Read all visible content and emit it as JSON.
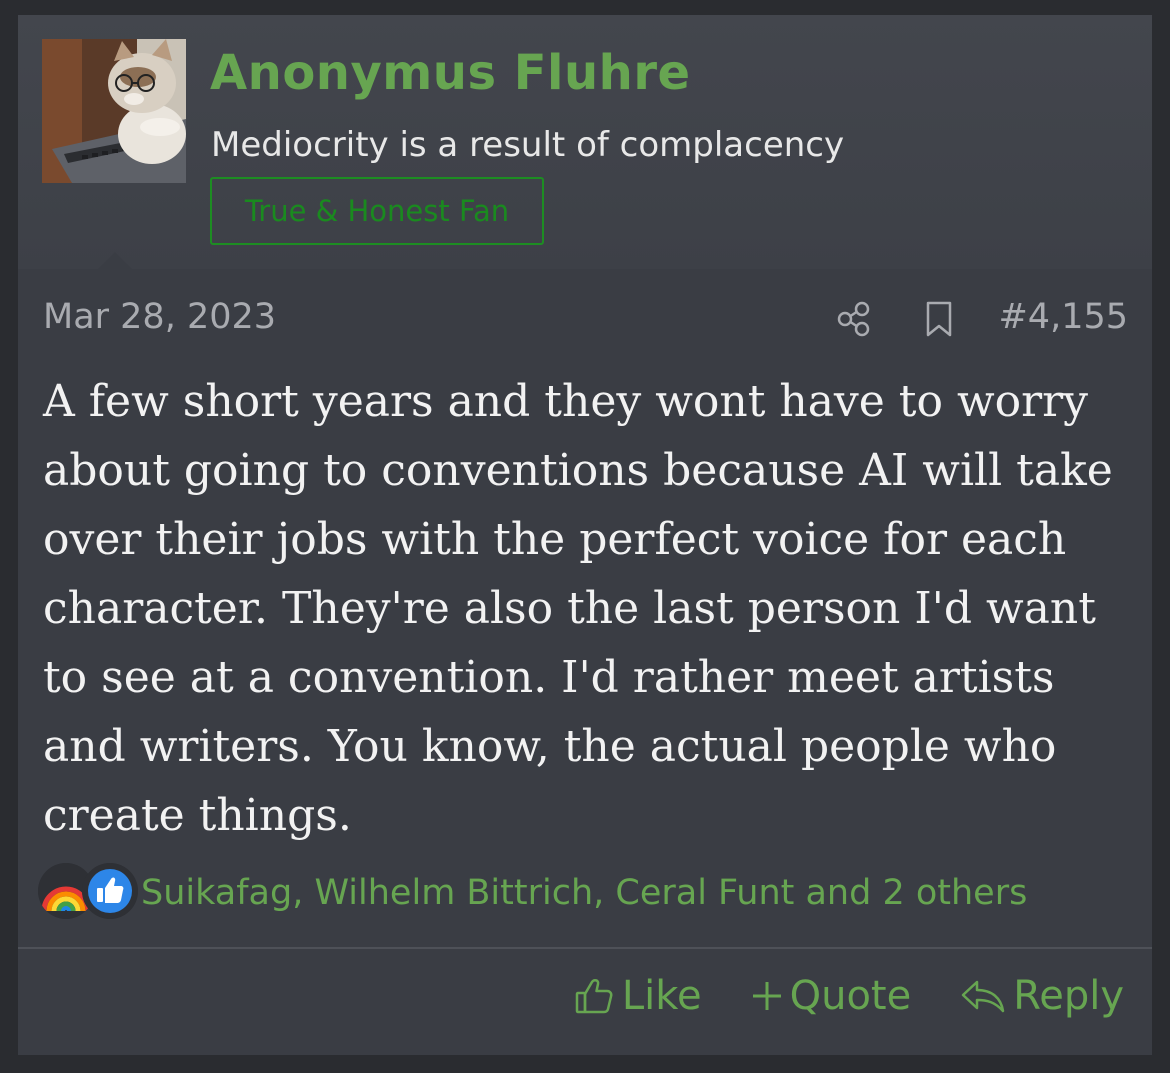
{
  "author": {
    "name": "Anonymus Fluhre",
    "title": "Mediocrity is a result of complacency",
    "banner": "True & Honest Fan"
  },
  "meta": {
    "date": "Mar 28, 2023",
    "post_number": "#4,155",
    "share_icon": "share-icon",
    "bookmark_icon": "bookmark-icon"
  },
  "message": {
    "text": "A few short years and they wont have to worry about going to conventions because AI will take over their jobs with the perfect voice for each character. They're also the last person I'd want to see at a convention. I'd rather meet artists and writers. You know, the actual people who create things."
  },
  "reactions": {
    "icons": [
      "rainbow-icon",
      "thumbs-up-icon"
    ],
    "users": "Suikafag, Wilhelm Bittrich, Ceral Funt and 2 others"
  },
  "actions": {
    "like": "Like",
    "quote": "Quote",
    "reply": "Reply"
  },
  "colors": {
    "accent": "#67a551",
    "banner_border": "#1d8d22",
    "background": "#3a3d44",
    "header_background": "#43464d"
  }
}
